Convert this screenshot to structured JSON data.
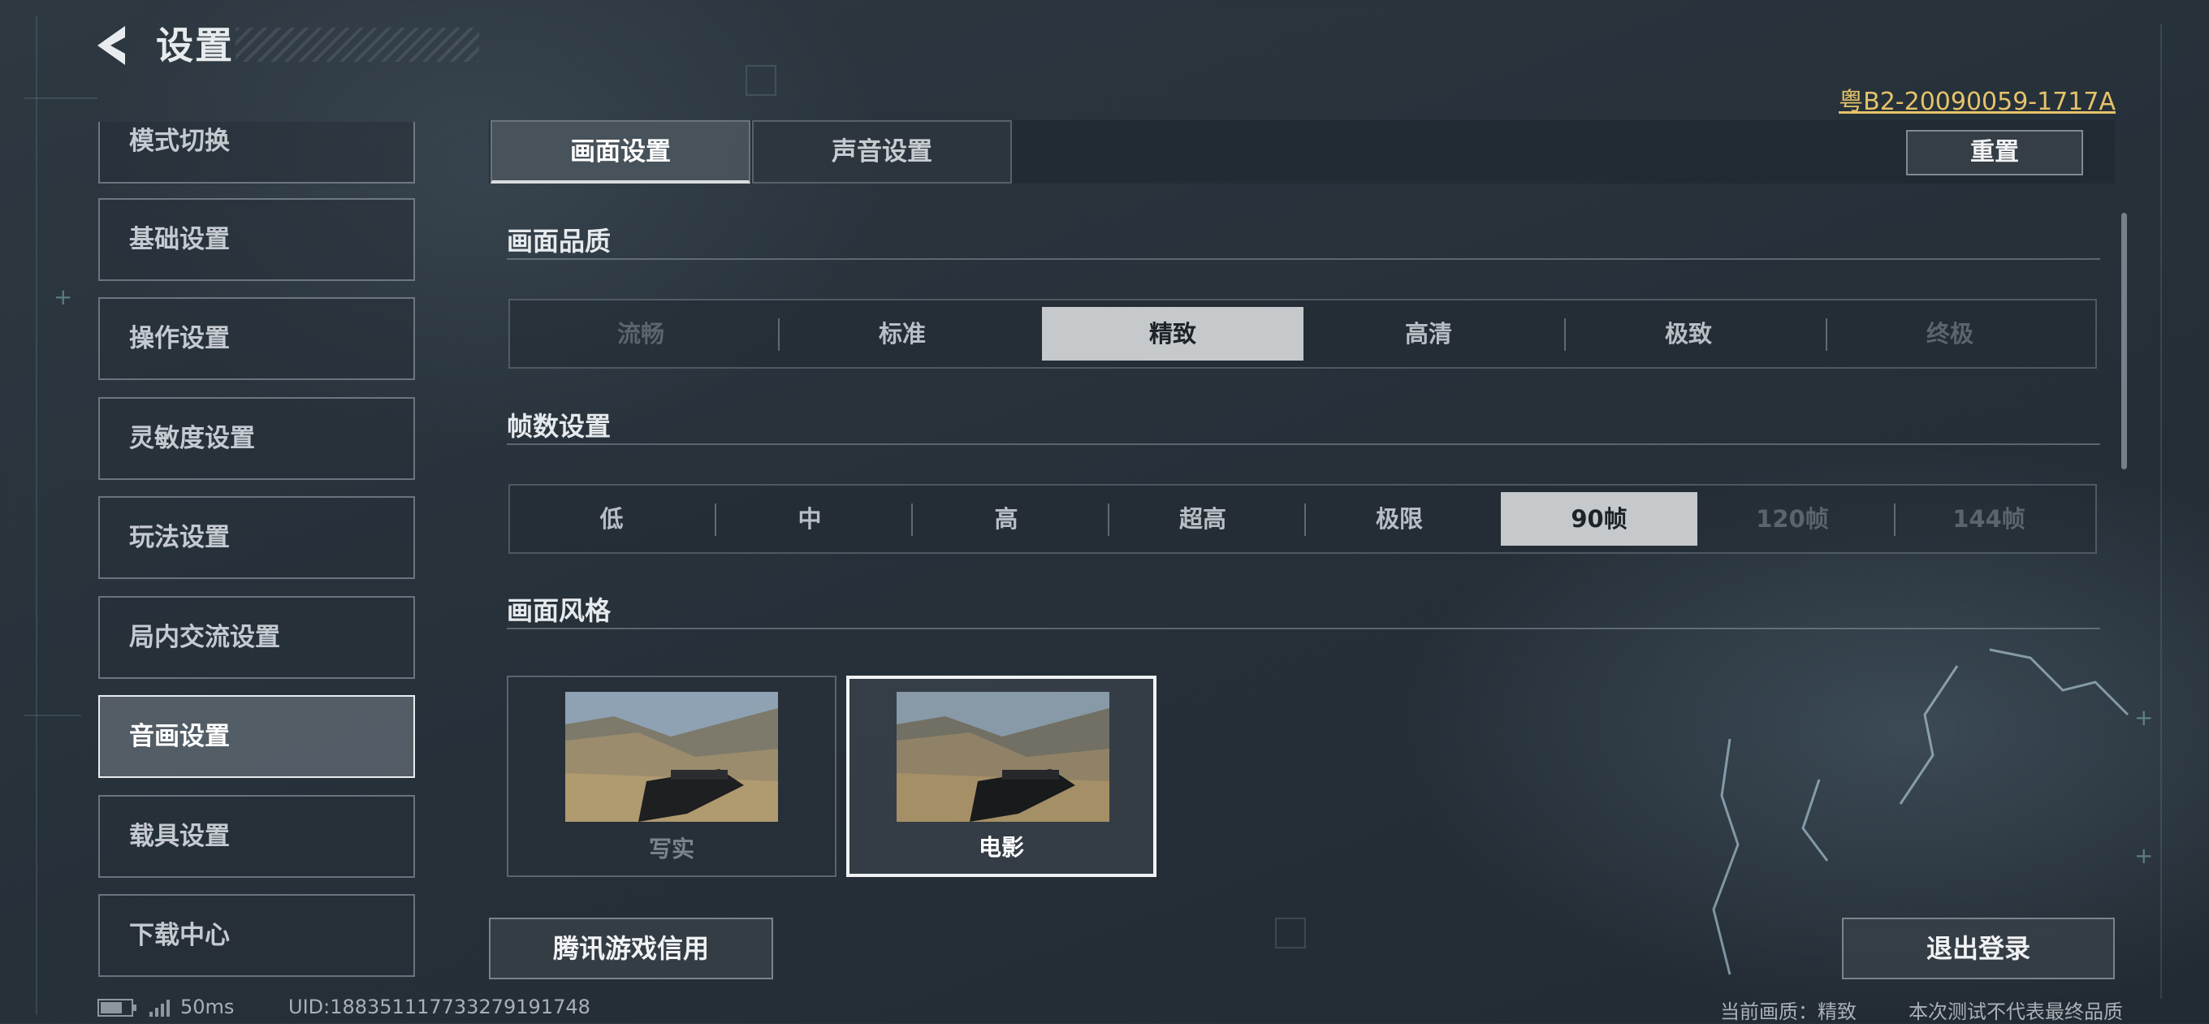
{
  "header": {
    "title": "设置",
    "back_icon": "chevron-left-icon",
    "license": "粤B2-20090059-1717A"
  },
  "sidebar": {
    "items": [
      {
        "label": "模式切换"
      },
      {
        "label": "基础设置"
      },
      {
        "label": "操作设置"
      },
      {
        "label": "灵敏度设置"
      },
      {
        "label": "玩法设置"
      },
      {
        "label": "局内交流设置"
      },
      {
        "label": "音画设置",
        "active": true
      },
      {
        "label": "载具设置"
      },
      {
        "label": "下载中心"
      }
    ]
  },
  "tabs": [
    {
      "label": "画面设置",
      "active": true
    },
    {
      "label": "声音设置"
    }
  ],
  "reset_label": "重置",
  "quality": {
    "title": "画面品质",
    "options": [
      "流畅",
      "标准",
      "精致",
      "高清",
      "极致",
      "终极"
    ],
    "selected": "精致",
    "disabled": [
      "流畅",
      "终极"
    ]
  },
  "framerate": {
    "title": "帧数设置",
    "options": [
      "低",
      "中",
      "高",
      "超高",
      "极限",
      "90帧",
      "120帧",
      "144帧"
    ],
    "selected": "90帧",
    "disabled": [
      "120帧",
      "144帧"
    ]
  },
  "style": {
    "title": "画面风格",
    "options": [
      {
        "label": "写实"
      },
      {
        "label": "电影",
        "selected": true
      }
    ]
  },
  "footer": {
    "credit_button": "腾讯游戏信用",
    "logout_button": "退出登录",
    "ping": "50ms",
    "uid": "UID:1883511177332791917​48",
    "current_quality": "当前画质：精致",
    "disclaimer": "本次测试不代表最终品质"
  },
  "colors": {
    "license": "#e5c36a",
    "selected_segment": "#c5c9cc"
  }
}
